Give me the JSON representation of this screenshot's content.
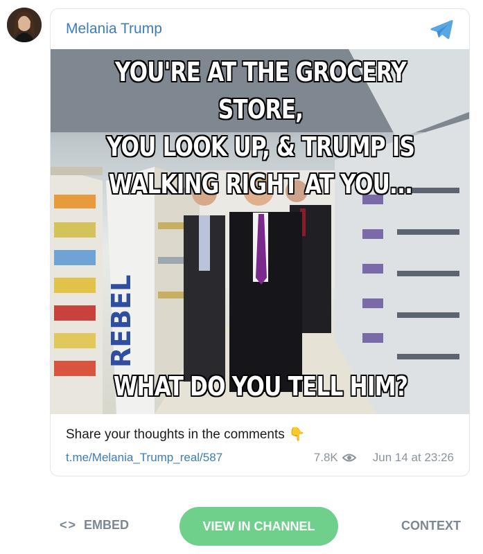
{
  "channel": {
    "name": "Melania Trump"
  },
  "post": {
    "meme_top_line1": "YOU'RE AT THE GROCERY STORE,",
    "meme_top_line2": "YOU LOOK UP, & TRUMP IS",
    "meme_top_line3": "WALKING RIGHT AT YOU...",
    "meme_bottom": "WHAT DO YOU TELL HIM?",
    "caption": "Share your thoughts in the comments",
    "caption_emoji": "👇",
    "link": "t.me/Melania_Trump_real/587",
    "views": "7.8K",
    "date": "Jun 14 at 23:26"
  },
  "footer": {
    "embed_icon": "<>",
    "embed_label": "EMBED",
    "view_label": "VIEW IN CHANNEL",
    "context_label": "CONTEXT"
  },
  "colors": {
    "link": "#3a7cc0",
    "button": "#6fd08c",
    "muted": "#8a939c"
  },
  "icons": [
    "avatar",
    "telegram-icon",
    "pointing-down-icon",
    "eye-icon",
    "code-icon"
  ]
}
